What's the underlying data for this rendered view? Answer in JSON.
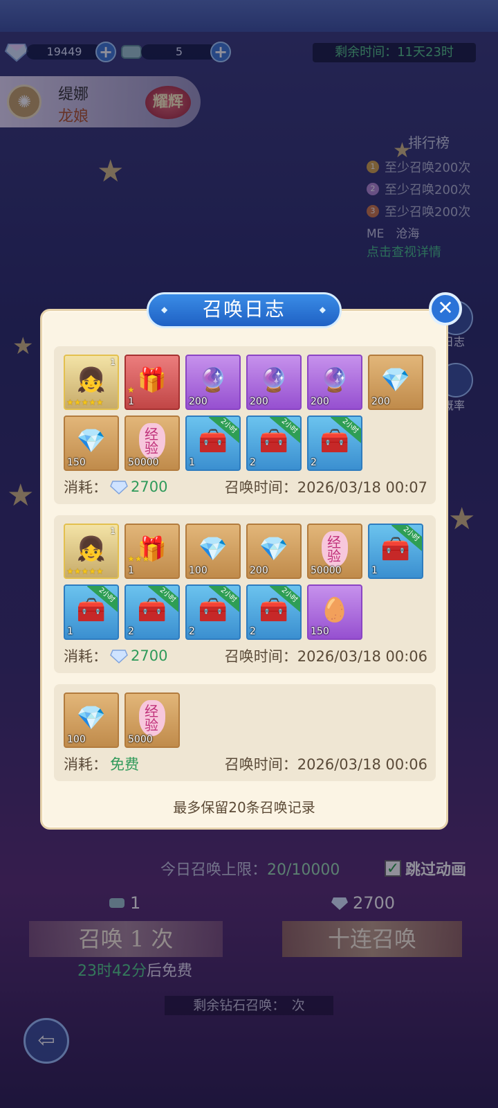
{
  "currency": {
    "gem_amount": "19449",
    "ticket_amount": "5",
    "plus": "+"
  },
  "timer": {
    "label": "剩余时间：11天23时"
  },
  "hero": {
    "name": "缇娜",
    "race": "龙娘",
    "badge": "耀辉"
  },
  "ranking": {
    "title": "排行榜",
    "rows": [
      "至少召唤200次",
      "至少召唤200次",
      "至少召唤200次"
    ],
    "me_label": "ME",
    "me_value": "沧海",
    "link": "点击查视详情"
  },
  "side": {
    "log_label": "日志",
    "rate_label": "概率"
  },
  "modal": {
    "title": "召唤日志",
    "close": "✕",
    "cost_label": "消耗：",
    "time_label": "召唤时间：",
    "footer": "最多保留20条召唤记录",
    "records": [
      {
        "items": [
          {
            "type": "hero",
            "lv": "1",
            "stars": "★★★★★",
            "icon": "hero-portrait"
          },
          {
            "type": "red",
            "qty": "1",
            "stars": "★",
            "icon": "mystery-box-red"
          },
          {
            "type": "purple",
            "qty": "200",
            "icon": "crystal-orb"
          },
          {
            "type": "purple",
            "qty": "200",
            "icon": "crystal-orb"
          },
          {
            "type": "purple",
            "qty": "200",
            "icon": "crystal-orb"
          },
          {
            "type": "gold",
            "qty": "200",
            "icon": "diamond"
          },
          {
            "type": "gold",
            "qty": "150",
            "icon": "diamond"
          },
          {
            "type": "gold",
            "qty": "50000",
            "icon": "exp-heart",
            "text": "经验"
          },
          {
            "type": "blue",
            "qty": "1",
            "tag": "2小时",
            "icon": "treasure-chest"
          },
          {
            "type": "blue",
            "qty": "2",
            "tag": "2小时",
            "icon": "treasure-chest"
          },
          {
            "type": "blue",
            "qty": "2",
            "tag": "2小时",
            "icon": "treasure-chest"
          }
        ],
        "cost": "2700",
        "time": "2026/03/18 00:07"
      },
      {
        "items": [
          {
            "type": "hero",
            "lv": "1",
            "stars": "★★★★★",
            "icon": "hero-portrait"
          },
          {
            "type": "gold",
            "qty": "1",
            "stars": "★★★",
            "icon": "mystery-box-gold"
          },
          {
            "type": "gold",
            "qty": "100",
            "icon": "diamond"
          },
          {
            "type": "gold",
            "qty": "200",
            "icon": "diamond"
          },
          {
            "type": "gold",
            "qty": "50000",
            "icon": "exp-heart",
            "text": "经验"
          },
          {
            "type": "blue",
            "qty": "1",
            "tag": "2小时",
            "icon": "treasure-chest"
          },
          {
            "type": "blue",
            "qty": "1",
            "tag": "2小时",
            "icon": "treasure-chest"
          },
          {
            "type": "blue",
            "qty": "2",
            "tag": "2小时",
            "icon": "treasure-chest"
          },
          {
            "type": "blue",
            "qty": "2",
            "tag": "2小时",
            "icon": "treasure-chest"
          },
          {
            "type": "blue",
            "qty": "2",
            "tag": "2小时",
            "icon": "treasure-chest"
          },
          {
            "type": "purple",
            "qty": "150",
            "icon": "golden-egg"
          }
        ],
        "cost": "2700",
        "time": "2026/03/18 00:06"
      },
      {
        "items": [
          {
            "type": "gold",
            "qty": "100",
            "icon": "diamond"
          },
          {
            "type": "gold",
            "qty": "5000",
            "icon": "exp-heart",
            "text": "经验"
          }
        ],
        "cost": "免费",
        "time": "2026/03/18 00:06"
      },
      {
        "items": [
          {
            "type": "purple",
            "qty": "",
            "icon": "crystal-orb"
          },
          {
            "type": "purple",
            "qty": "",
            "icon": "crystal-orb"
          },
          {
            "type": "gold",
            "qty": "",
            "icon": "diamond"
          },
          {
            "type": "gold",
            "qty": "",
            "icon": "diamond"
          },
          {
            "type": "gold",
            "qty": "",
            "icon": "diamond"
          },
          {
            "type": "blue",
            "qty": "",
            "icon": "treasure-chest"
          }
        ],
        "cost": "",
        "time": ""
      }
    ]
  },
  "bottom": {
    "limit_label": "今日召唤上限：",
    "limit_value": "20/10000",
    "skip_label": "跳过动画",
    "single_cost": "1",
    "ten_cost": "2700",
    "single_btn": "召唤 1 次",
    "ten_btn": "十连召唤",
    "free_time": "23时42分",
    "free_suffix": "后免费",
    "remain_prefix": "剩余钻石召唤：",
    "remain_suffix": "次"
  },
  "colors": {
    "accent_green": "#2f9a5a",
    "modal_bg": "#fbf4e4",
    "title_blue": "#1f61c4"
  }
}
